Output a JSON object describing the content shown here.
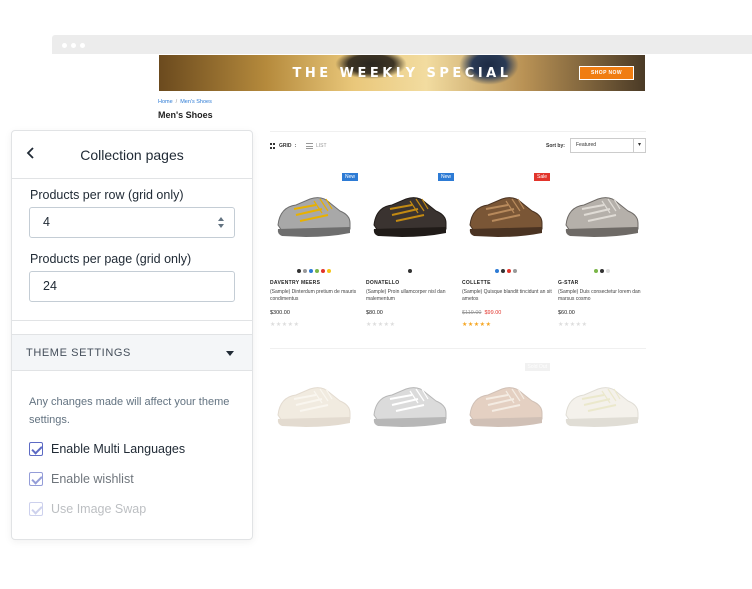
{
  "banner": {
    "title": "THE WEEKLY SPECIAL",
    "cta": "SHOP NOW"
  },
  "breadcrumb": {
    "home": "Home",
    "current": "Men's Shoes"
  },
  "collection": {
    "title": "Men's Shoes"
  },
  "toolbar": {
    "grid_label": "GRID",
    "list_label": "LIST",
    "sort_label": "Sort by:",
    "sort_value": "Featured"
  },
  "products": [
    {
      "badge": "New",
      "badge_type": "new",
      "vendor": "DAVENTRY MEERS",
      "name": "(Sample) Dinterdum pretium de mauris condimentus",
      "price": "$300.00",
      "old_price": "",
      "rating": 0,
      "swatches": [
        "#333333",
        "#999999",
        "#2d7bd5",
        "#7ab648",
        "#e2342b",
        "#f5c518"
      ],
      "colors": [
        "#a8a8a8",
        "#6e6e6e",
        "#e8b100"
      ]
    },
    {
      "badge": "New",
      "badge_type": "new",
      "vendor": "DONATELLO",
      "name": "(Sample) Proin ullamcorper nisl dan malementum",
      "price": "$80.00",
      "old_price": "",
      "rating": 0,
      "swatches": [
        "#333333"
      ],
      "colors": [
        "#3a3330",
        "#201b18",
        "#c28a12"
      ]
    },
    {
      "badge": "Sale",
      "badge_type": "sale",
      "vendor": "COLLETTE",
      "name": "(Sample) Quisque blandit tincidunt an sit ametos",
      "price": "$99.00",
      "old_price": "$119.00",
      "rating": 5,
      "swatches": [
        "#2d7bd5",
        "#333333",
        "#e2342b",
        "#999999"
      ],
      "colors": [
        "#7a5636",
        "#4a3322",
        "#b88a5c"
      ]
    },
    {
      "badge": "",
      "badge_type": "",
      "vendor": "G-STAR",
      "name": "(Sample) Duis consectetur lorem dan marsus cosmo",
      "price": "$60.00",
      "old_price": "",
      "rating": 0,
      "swatches": [
        "#7ab648",
        "#333333",
        "#dddddd"
      ],
      "colors": [
        "#b5b0aa",
        "#6e6a66",
        "#e0dcd6"
      ]
    }
  ],
  "products_row2": [
    {
      "badge": "",
      "badge_type": "",
      "colors": [
        "#d9c7a8",
        "#b09a7a",
        "#f0e6d4"
      ]
    },
    {
      "badge": "",
      "badge_type": "",
      "colors": [
        "#9a9a9a",
        "#333333",
        "#ffffff"
      ]
    },
    {
      "badge": "Sold Out",
      "badge_type": "soldout",
      "colors": [
        "#b57c52",
        "#7a4e30",
        "#e0c9b0"
      ]
    },
    {
      "badge": "",
      "badge_type": "",
      "colors": [
        "#e0dac8",
        "#a8a08a",
        "#c8c070"
      ]
    }
  ],
  "panel": {
    "title": "Collection pages",
    "products_per_row_label": "Products per row (grid only)",
    "products_per_row_value": "4",
    "products_per_page_label": "Products per page (grid only)",
    "products_per_page_value": "24",
    "theme_settings_title": "THEME SETTINGS",
    "help_text": "Any changes made will affect your theme settings.",
    "checkboxes": [
      {
        "label": "Enable Multi Languages",
        "checked": true
      },
      {
        "label": "Enable wishlist",
        "checked": true
      },
      {
        "label": "Use Image Swap",
        "checked": true
      }
    ]
  }
}
